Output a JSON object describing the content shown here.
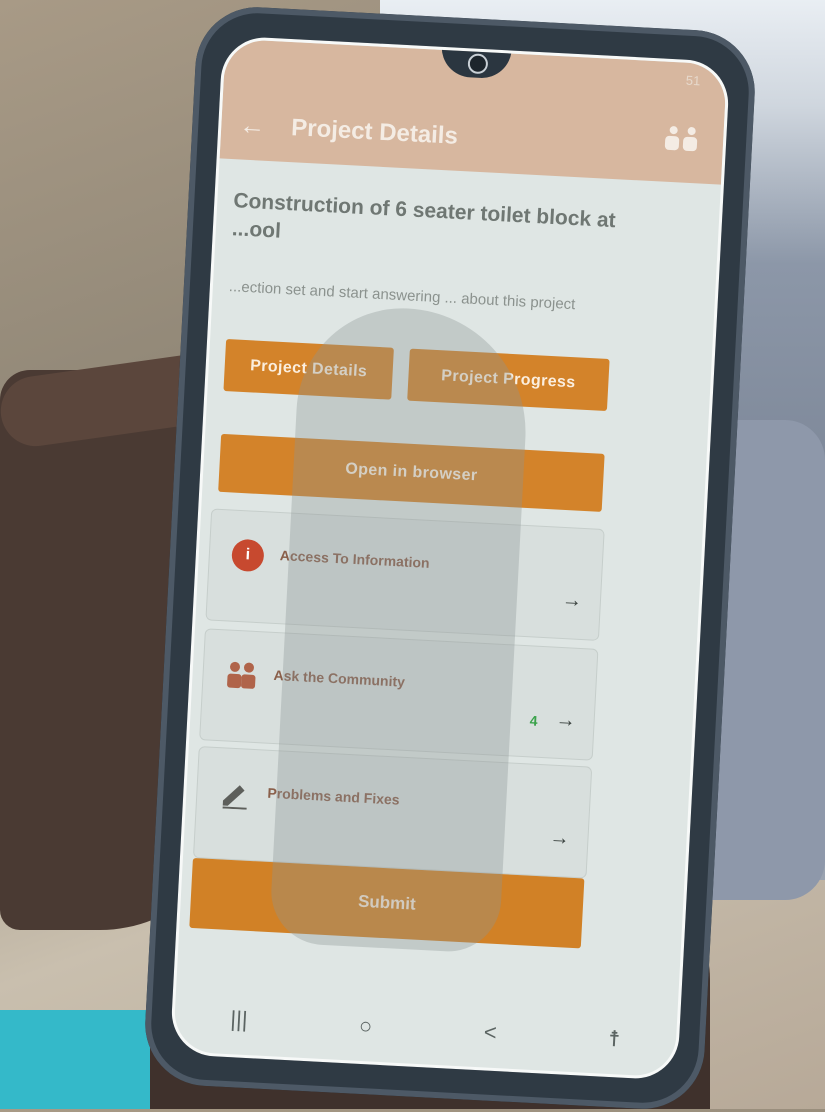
{
  "status_bar": {
    "battery": "51"
  },
  "app_bar": {
    "title": "Project Details",
    "back_icon": "back-arrow-icon",
    "menu_icon": "group-icon"
  },
  "project": {
    "heading": "Construction of 6 seater toilet block at",
    "heading_line2": "...ool",
    "instructions": "...ection set and start answering ... about this project"
  },
  "buttons": {
    "project_details": "Project Details",
    "project_progress": "Project Progress",
    "open_browser": "Open in browser",
    "submit": "Submit"
  },
  "cards": [
    {
      "label": "Access To Information",
      "icon": "info-icon",
      "count": "",
      "arrow": "→"
    },
    {
      "label": "Ask the Community",
      "icon": "people-icon",
      "count": "4",
      "arrow": "→"
    },
    {
      "label": "Problems and Fixes",
      "icon": "pencil-icon",
      "count": "",
      "arrow": "→"
    }
  ],
  "nav": {
    "recent": "|||",
    "home": "○",
    "back": "<",
    "accessibility": "☨"
  },
  "colors": {
    "accent": "#d3832a",
    "info": "#c7492f",
    "count": "#3aa24a"
  }
}
